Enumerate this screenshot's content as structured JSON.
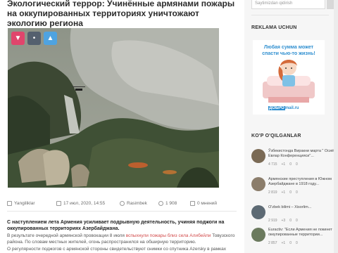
{
  "article": {
    "title": "Экологический террор: Учинённые армянами пожары на оккупированных территориях уничтожают экологию региона",
    "meta": {
      "category": "Yangiliklar",
      "date": "17 июл, 2020, 14:55",
      "author": "Rasimbek",
      "views": "1 908",
      "comments": "0 мнений"
    },
    "lead": "С наступлением лета Армения усиливает подрывную деятельность, учиняя поджоги на оккупированных территориях Азербайджана.",
    "p1_before": "В результате очередной армянской провокации 8 июля ",
    "p1_link": "вспыхнули пожары близ села Алибейли",
    "p1_after": " Товузского района. По словам местных жителей, огонь распространился на обширную территорию.",
    "p2": "О регулярности поджогов с армянской стороны свидетельствуют снимки со спутника Azersky в рамках"
  },
  "share": {
    "dislike_icon": "thumbs-down-icon",
    "middle_icon": "counter-icon",
    "like_icon": "thumbs-up-icon",
    "colors": {
      "dislike": "#e0456c",
      "middle": "#54606e",
      "like": "#4fa3e0"
    }
  },
  "sidebar": {
    "search_placeholder": "Saytimizdan qidirish",
    "ad_heading": "REKLAMA UCHUN",
    "ad": {
      "text": "Любая сумма может спасти чью-то жизнь!",
      "logo_box": "ДОБРО",
      "logo_rest": "mail.ru"
    },
    "most_read_heading": "KO'P O'QILGANLAR",
    "most_read": [
      {
        "title": "Ўзбекистонда Виракни марта \" Осиё Евлар Конференцияси\"...",
        "views": "4 715",
        "likes": "+1",
        "dislikes": "0",
        "comments": "0"
      },
      {
        "title": "Армянские преступления в Южном Азербайджане в 1918 году...",
        "views": "2 819",
        "likes": "+1",
        "dislikes": "0",
        "comments": "0"
      },
      {
        "title": "O'zbek bilimi – Xisorlim...",
        "views": "2 919",
        "likes": "+3",
        "dislikes": "0",
        "comments": "0"
      },
      {
        "title": "Euractiv: \"Если Армения не покинет оккупированные территории...",
        "views": "2 857",
        "likes": "+1",
        "dislikes": "0",
        "comments": "0"
      }
    ]
  }
}
